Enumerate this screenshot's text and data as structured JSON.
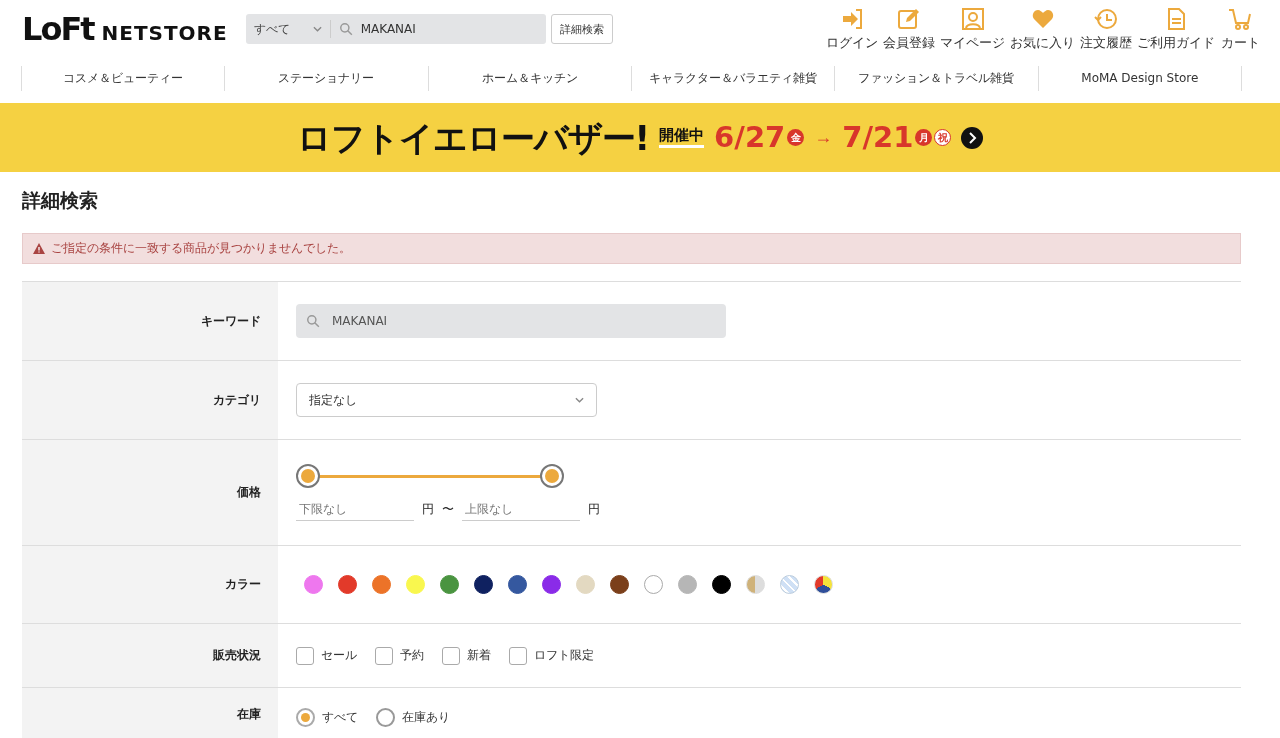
{
  "header": {
    "logo": "LoFt",
    "logo_sub": "NETSTORE",
    "search": {
      "scope": "すべて",
      "value": "MAKANAI"
    },
    "advanced_button": "詳細検索",
    "utilities": [
      {
        "kind": "login",
        "label": "ログイン"
      },
      {
        "kind": "register",
        "label": "会員登録"
      },
      {
        "kind": "mypage",
        "label": "マイページ"
      },
      {
        "kind": "favorites",
        "label": "お気に入り"
      },
      {
        "kind": "history",
        "label": "注文履歴"
      },
      {
        "kind": "guide",
        "label": "ご利用ガイド"
      },
      {
        "kind": "cart",
        "label": "カート"
      }
    ]
  },
  "nav": [
    "コスメ＆ビューティー",
    "ステーショナリー",
    "ホーム＆キッチン",
    "キャラクター＆バラエティ雑貨",
    "ファッション＆トラベル雑貨",
    "MoMA Design Store"
  ],
  "banner": {
    "title": "ロフトイエローバザー!",
    "status": "開催中",
    "start": "6/27",
    "start_day": "金",
    "arrow": "→",
    "end": "7/21",
    "end_day": "月",
    "end_holiday": "祝"
  },
  "page_title": "詳細検索",
  "alert": "ご指定の条件に一致する商品が見つかりませんでした。",
  "form": {
    "keyword": {
      "label": "キーワード",
      "value": "MAKANAI"
    },
    "category": {
      "label": "カテゴリ",
      "value": "指定なし"
    },
    "price": {
      "label": "価格",
      "min_thumb": {
        "level": 0
      },
      "max_thumb": {
        "level": 1
      },
      "min_placeholder": "下限なし",
      "max_placeholder": "上限なし",
      "unit_min": "円",
      "separator": "〜",
      "unit_max": "円"
    },
    "color": {
      "label": "カラー",
      "swatches": [
        {
          "kind": "solid",
          "color": "#ee77ee"
        },
        {
          "kind": "solid",
          "color": "#e23a2a"
        },
        {
          "kind": "solid",
          "color": "#ec7328"
        },
        {
          "kind": "solid",
          "color": "#f9f74e"
        },
        {
          "kind": "solid",
          "color": "#4a9440"
        },
        {
          "kind": "solid",
          "color": "#0f2160"
        },
        {
          "kind": "solid",
          "color": "#35589f"
        },
        {
          "kind": "solid",
          "color": "#8a2be8"
        },
        {
          "kind": "solid",
          "color": "#e3d9c1"
        },
        {
          "kind": "solid",
          "color": "#7b3f1a"
        },
        {
          "kind": "solid",
          "color": "#ffffff"
        },
        {
          "kind": "solid",
          "color": "#b6b6b6"
        },
        {
          "kind": "solid",
          "color": "#000000"
        },
        {
          "kind": "half"
        },
        {
          "kind": "clear"
        },
        {
          "kind": "multi"
        }
      ]
    },
    "status": {
      "label": "販売状況",
      "options": [
        {
          "label": "セール",
          "checked": false
        },
        {
          "label": "予約",
          "checked": false
        },
        {
          "label": "新着",
          "checked": false
        },
        {
          "label": "ロフト限定",
          "checked": false
        }
      ]
    },
    "stock": {
      "label": "在庫",
      "options": [
        {
          "label": "すべて",
          "selected": true
        },
        {
          "label": "在庫あり",
          "selected": false
        }
      ]
    }
  }
}
